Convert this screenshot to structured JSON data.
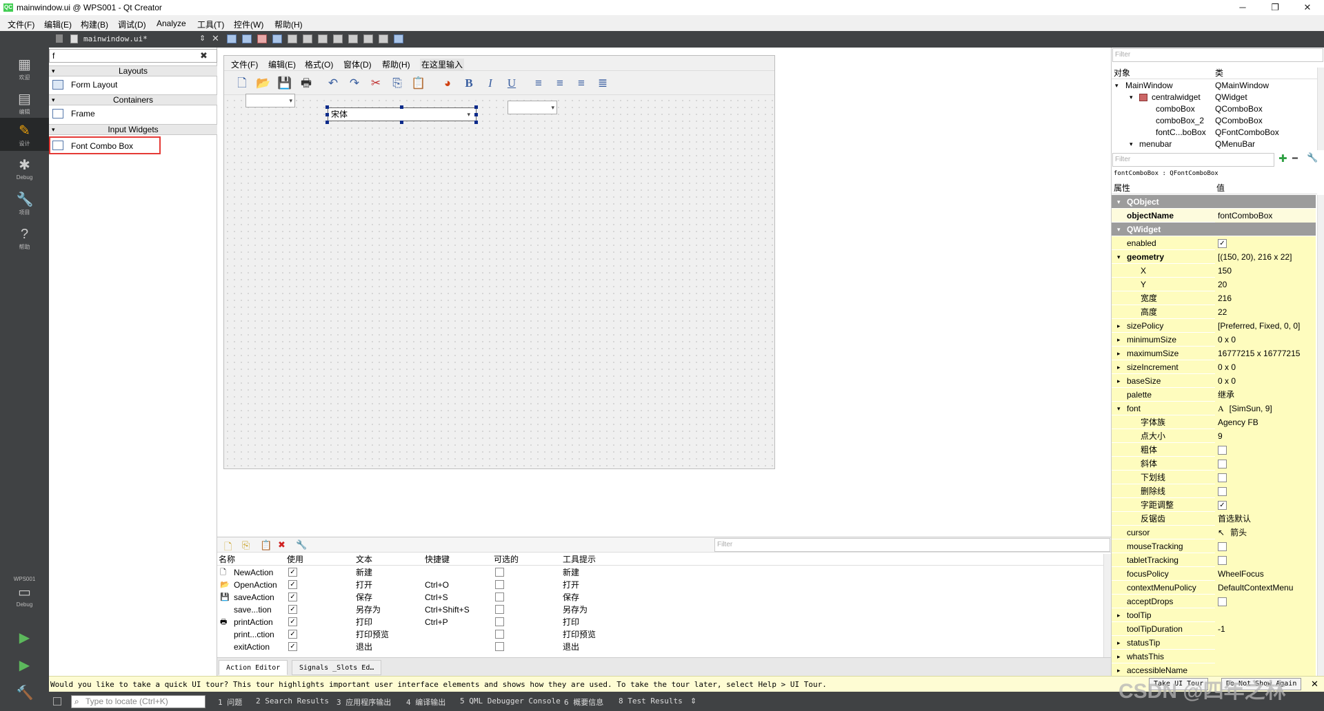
{
  "window": {
    "title": "mainwindow.ui @ WPS001 - Qt Creator",
    "app_icon": "QC",
    "min_glyph": "─",
    "max_glyph": "❐",
    "close_glyph": "✕"
  },
  "menu": [
    "文件(F)",
    "编辑(E)",
    "构建(B)",
    "调试(D)",
    "Analyze",
    "工具(T)",
    "控件(W)",
    "帮助(H)"
  ],
  "modes": [
    {
      "label": "欢迎",
      "glyph": "▦"
    },
    {
      "label": "编辑",
      "glyph": "▤"
    },
    {
      "label": "设计",
      "glyph": "✎"
    },
    {
      "label": "Debug",
      "glyph": "✱"
    },
    {
      "label": "项目",
      "glyph": "🔧"
    },
    {
      "label": "帮助",
      "glyph": "?"
    }
  ],
  "kit": {
    "name": "WPS001",
    "label": "Debug",
    "glyph": "▭"
  },
  "run_glyphs": {
    "run": "▶",
    "debug": "▶",
    "build": "🔨"
  },
  "document": {
    "filename": "mainwindow.ui*"
  },
  "widget_box": {
    "search_value": "f",
    "clear_glyph": "✖",
    "categories": [
      {
        "name": "Layouts",
        "items": [
          "Form Layout"
        ]
      },
      {
        "name": "Containers",
        "items": [
          "Frame"
        ]
      },
      {
        "name": "Input Widgets",
        "items": [
          "Font Combo Box"
        ]
      }
    ]
  },
  "form": {
    "menu": [
      "文件(F)",
      "编辑(E)",
      "格式(O)",
      "窗体(D)",
      "帮助(H)",
      "在这里输入"
    ],
    "toolbar_icons": [
      "new-file-icon",
      "open-icon",
      "save-icon",
      "print-icon",
      "undo-icon",
      "redo-icon",
      "cut-icon",
      "copy-icon",
      "paste-icon",
      "color-icon",
      "bold-icon",
      "italic-icon",
      "underline-icon",
      "align-left-icon",
      "align-center-icon",
      "align-right-icon",
      "justify-icon"
    ],
    "toolbar_glyphs": [
      "🗋",
      "📂",
      "💾",
      "🖶",
      "↶",
      "↷",
      "✂",
      "⎘",
      "📋",
      "◕",
      "B",
      "I",
      "U",
      "≡",
      "≡",
      "≡",
      "≣"
    ],
    "font_combo_value": "宋体",
    "combo_arrow": "▾"
  },
  "object_inspector": {
    "filter_placeholder": "Filter",
    "headers": [
      "对象",
      "类"
    ],
    "rows": [
      {
        "name": "MainWindow",
        "class": "QMainWindow",
        "indent": 0
      },
      {
        "name": "centralwidget",
        "class": "QWidget",
        "indent": 1
      },
      {
        "name": "comboBox",
        "class": "QComboBox",
        "indent": 2
      },
      {
        "name": "comboBox_2",
        "class": "QComboBox",
        "indent": 2
      },
      {
        "name": "fontC...boBox",
        "class": "QFontComboBox",
        "indent": 2
      },
      {
        "name": "menubar",
        "class": "QMenuBar",
        "indent": 1
      }
    ]
  },
  "property_editor": {
    "filter_placeholder": "Filter",
    "add_glyph": "✚",
    "remove_glyph": "━",
    "config_glyph": "🔧",
    "context": "fontComboBox : QFontComboBox",
    "headers": [
      "属性",
      "值"
    ],
    "sections": {
      "qobject": "QObject",
      "qwidget": "QWidget"
    },
    "rows": {
      "objectName": {
        "name": "objectName",
        "value": "fontComboBox"
      },
      "enabled": {
        "name": "enabled",
        "check": "✓"
      },
      "geometry": {
        "name": "geometry",
        "value": "[(150, 20), 216 x 22]"
      },
      "gx": {
        "name": "X",
        "value": "150"
      },
      "gy": {
        "name": "Y",
        "value": "20"
      },
      "gw": {
        "name": "宽度",
        "value": "216"
      },
      "gh": {
        "name": "高度",
        "value": "22"
      },
      "sizePolicy": {
        "name": "sizePolicy",
        "value": "[Preferred, Fixed, 0, 0]"
      },
      "minimumSize": {
        "name": "minimumSize",
        "value": "0 x 0"
      },
      "maximumSize": {
        "name": "maximumSize",
        "value": "16777215 x 16777215"
      },
      "sizeIncrement": {
        "name": "sizeIncrement",
        "value": "0 x 0"
      },
      "baseSize": {
        "name": "baseSize",
        "value": "0 x 0"
      },
      "palette": {
        "name": "palette",
        "value": "继承"
      },
      "font": {
        "name": "font",
        "value": "[SimSun, 9]"
      },
      "fontFamily": {
        "name": "字体族",
        "value": "Agency FB"
      },
      "pointSize": {
        "name": "点大小",
        "value": "9"
      },
      "bold": {
        "name": "粗体"
      },
      "italic": {
        "name": "斜体"
      },
      "underline": {
        "name": "下划线"
      },
      "strikeout": {
        "name": "删除线"
      },
      "kerning": {
        "name": "字距调整",
        "check": "✓"
      },
      "antialias": {
        "name": "反锯齿",
        "value": "首选默认"
      },
      "cursor": {
        "name": "cursor",
        "value": "箭头"
      },
      "mouseTracking": {
        "name": "mouseTracking"
      },
      "tabletTracking": {
        "name": "tabletTracking"
      },
      "focusPolicy": {
        "name": "focusPolicy",
        "value": "WheelFocus"
      },
      "contextMenuPolicy": {
        "name": "contextMenuPolicy",
        "value": "DefaultContextMenu"
      },
      "acceptDrops": {
        "name": "acceptDrops"
      },
      "toolTip": {
        "name": "toolTip"
      },
      "toolTipDuration": {
        "name": "toolTipDuration",
        "value": "-1"
      },
      "statusTip": {
        "name": "statusTip"
      },
      "whatsThis": {
        "name": "whatsThis"
      },
      "accessibleName": {
        "name": "accessibleName"
      }
    }
  },
  "action_editor": {
    "filter_placeholder": "Filter",
    "headers": [
      "名称",
      "使用",
      "文本",
      "快捷键",
      "可选的",
      "工具提示"
    ],
    "used_check": "✓",
    "rows": [
      {
        "name": "NewAction",
        "text": "新建",
        "shortcut": "",
        "tooltip": "新建",
        "icon": "🗋"
      },
      {
        "name": "OpenAction",
        "text": "打开",
        "shortcut": "Ctrl+O",
        "tooltip": "打开",
        "icon": "📂"
      },
      {
        "name": "saveAction",
        "text": "保存",
        "shortcut": "Ctrl+S",
        "tooltip": "保存",
        "icon": "💾"
      },
      {
        "name": "save...tion",
        "text": "另存为",
        "shortcut": "Ctrl+Shift+S",
        "tooltip": "另存为",
        "icon": ""
      },
      {
        "name": "printAction",
        "text": "打印",
        "shortcut": "Ctrl+P",
        "tooltip": "打印",
        "icon": "🖶"
      },
      {
        "name": "print...ction",
        "text": "打印预览",
        "shortcut": "",
        "tooltip": "打印预览",
        "icon": ""
      },
      {
        "name": "exitAction",
        "text": "退出",
        "shortcut": "",
        "tooltip": "退出",
        "icon": ""
      }
    ],
    "tabs": [
      "Action Editor",
      "Signals _Slots Ed…"
    ]
  },
  "tour": {
    "message": "Would you like to take a quick UI tour? This tour highlights important user interface elements and shows how they are used. To take the tour later, select Help > UI Tour.",
    "take_label": "Take UI Tour",
    "dont_label": "Do Not Show Again",
    "close_glyph": "✕"
  },
  "statusbar": {
    "locator_placeholder": "Type to locate (Ctrl+K)",
    "search_glyph": "⌕",
    "tabs": [
      "1 问题",
      "2 Search Results",
      "3 应用程序输出",
      "4 编译输出",
      "5 QML Debugger Console",
      "6 概要信息",
      "8 Test Results"
    ],
    "updown_glyph": "⇕"
  },
  "watermark": "CSDN @四年之林"
}
